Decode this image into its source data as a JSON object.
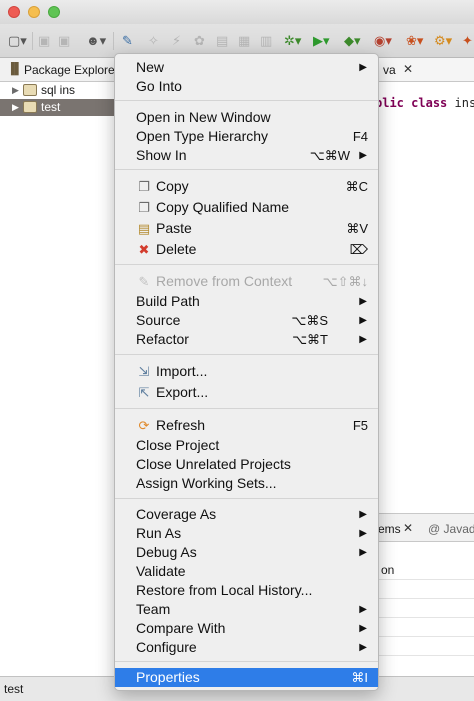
{
  "window": {
    "traffic_lights": [
      "close",
      "minimize",
      "maximize"
    ]
  },
  "toolbar": {
    "icons": [
      "new-wizard-icon",
      "save-icon",
      "save-all-icon",
      "console-icon",
      "pin-icon",
      "debug-icon",
      "run-icon",
      "coverage-icon",
      "external-tools-icon",
      "search-icon",
      "open-type-icon"
    ]
  },
  "package_explorer": {
    "tab_label": "Package Explorer",
    "items": [
      {
        "label": "sql ins",
        "selected": false
      },
      {
        "label": "test",
        "selected": true
      }
    ]
  },
  "editor": {
    "tab_label": "va",
    "code_keywords": [
      "blic",
      "class"
    ],
    "code_rest": "ins"
  },
  "bottom_panel": {
    "tab1_label": "ems",
    "tab2_label": "@ Javad",
    "row_text": "on"
  },
  "status": {
    "text": "test"
  },
  "context_menu": {
    "new": {
      "label": "New",
      "submenu": true
    },
    "go_into": {
      "label": "Go Into"
    },
    "open_new_window": {
      "label": "Open in New Window"
    },
    "open_type_hierarchy": {
      "label": "Open Type Hierarchy",
      "shortcut": "F4"
    },
    "show_in": {
      "label": "Show In",
      "shortcut": "⌥⌘W",
      "submenu": true
    },
    "copy": {
      "label": "Copy",
      "shortcut": "⌘C",
      "icon": "copy-icon"
    },
    "copy_qualified_name": {
      "label": "Copy Qualified Name",
      "icon": "copy-qualified-name-icon"
    },
    "paste": {
      "label": "Paste",
      "shortcut": "⌘V",
      "icon": "paste-icon"
    },
    "delete": {
      "label": "Delete",
      "shortcut": "⌦",
      "icon": "delete-icon"
    },
    "remove_from_context": {
      "label": "Remove from Context",
      "shortcut": "⌥⇧⌘↓",
      "disabled": true,
      "icon": "remove-context-icon"
    },
    "build_path": {
      "label": "Build Path",
      "submenu": true
    },
    "source": {
      "label": "Source",
      "shortcut": "⌥⌘S",
      "submenu": true
    },
    "refactor": {
      "label": "Refactor",
      "shortcut": "⌥⌘T",
      "submenu": true
    },
    "import": {
      "label": "Import...",
      "icon": "import-icon"
    },
    "export": {
      "label": "Export...",
      "icon": "export-icon"
    },
    "refresh": {
      "label": "Refresh",
      "shortcut": "F5",
      "icon": "refresh-icon"
    },
    "close_project": {
      "label": "Close Project"
    },
    "close_unrelated_projects": {
      "label": "Close Unrelated Projects"
    },
    "assign_working_sets": {
      "label": "Assign Working Sets..."
    },
    "coverage_as": {
      "label": "Coverage As",
      "submenu": true
    },
    "run_as": {
      "label": "Run As",
      "submenu": true
    },
    "debug_as": {
      "label": "Debug As",
      "submenu": true
    },
    "validate": {
      "label": "Validate"
    },
    "restore_local_history": {
      "label": "Restore from Local History..."
    },
    "team": {
      "label": "Team",
      "submenu": true
    },
    "compare_with": {
      "label": "Compare With",
      "submenu": true
    },
    "configure": {
      "label": "Configure",
      "submenu": true
    },
    "properties": {
      "label": "Properties",
      "shortcut": "⌘I",
      "highlighted": true
    }
  },
  "colors": {
    "menu_highlight": "#2e7de8",
    "tree_selection": "#7a7470",
    "keyword": "#7f0055"
  }
}
